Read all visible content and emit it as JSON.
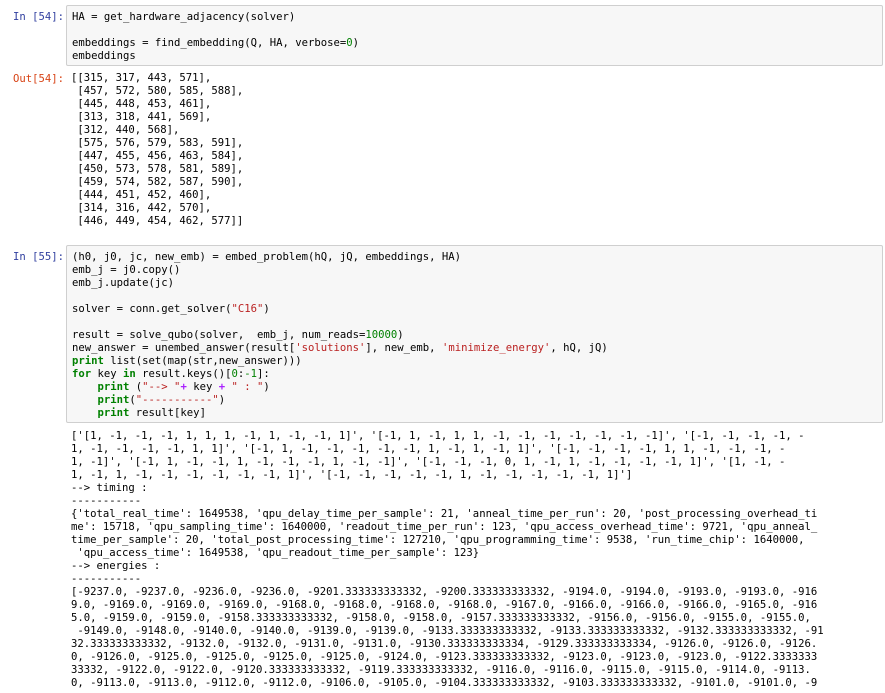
{
  "cells": [
    {
      "in_prompt": "In [54]:",
      "code": {
        "line1": "HA = get_hardware_adjacency(solver)",
        "line2_a": "embeddings = find_embedding(Q, HA, verbose=",
        "line2_num": "0",
        "line2_b": ")",
        "line3": "embeddings"
      },
      "out_prompt": "Out[54]:",
      "output_lines": [
        "[[315, 317, 443, 571],",
        " [457, 572, 580, 585, 588],",
        " [445, 448, 453, 461],",
        " [313, 318, 441, 569],",
        " [312, 440, 568],",
        " [575, 576, 579, 583, 591],",
        " [447, 455, 456, 463, 584],",
        " [450, 573, 578, 581, 589],",
        " [459, 574, 582, 587, 590],",
        " [444, 451, 452, 460],",
        " [314, 316, 442, 570],",
        " [446, 449, 454, 462, 577]]"
      ]
    },
    {
      "in_prompt": "In [55]:",
      "code": {
        "l1": "(h0, j0, jc, new_emb) = embed_problem(hQ, jQ, embeddings, HA)",
        "l2": "emb_j = j0.copy()",
        "l3": "emb_j.update(jc)",
        "l4_a": "solver = conn.get_solver(",
        "l4_str": "\"C16\"",
        "l4_b": ")",
        "l5_a": "result = solve_qubo(solver,  emb_j, num_reads=",
        "l5_num": "10000",
        "l5_b": ")",
        "l6_a": "new_answer = unembed_answer(result[",
        "l6_str1": "'solutions'",
        "l6_b": "], new_emb, ",
        "l6_str2": "'minimize_energy'",
        "l6_c": ", hQ, jQ)",
        "l7_kw": "print",
        "l7_rest": " list(set(map(str,new_answer)))",
        "l8_kw1": "for",
        "l8_a": " key ",
        "l8_kw2": "in",
        "l8_b": " result.keys()[",
        "l8_n1": "0",
        "l8_c": ":",
        "l8_n2": "-1",
        "l8_d": "]:",
        "l9_kw": "print",
        "l9_a": " (",
        "l9_str1": "\"--> \"",
        "l9_op1": "+",
        "l9_b": " key ",
        "l9_op2": "+",
        "l9_str2": "\" : \"",
        "l9_c": ")",
        "l10_kw": "print",
        "l10_a": "(",
        "l10_str": "\"-----------\"",
        "l10_b": ")",
        "l11_kw": "print",
        "l11_a": " result[key]"
      },
      "stdout_lines": [
        "['[1, -1, -1, -1, 1, 1, 1, -1, 1, -1, -1, 1]', '[-1, 1, -1, 1, 1, -1, -1, -1, -1, -1, -1, -1]', '[-1, -1, -1, -1, -",
        "1, -1, -1, -1, -1, 1, 1]', '[-1, 1, -1, -1, -1, -1, -1, 1, -1, 1, -1, 1]', '[-1, -1, -1, -1, 1, 1, -1, -1, -1, -",
        "1, -1]', '[-1, 1, -1, -1, 1, -1, -1, -1, 1, -1, -1]', '[-1, -1, -1, 0, 1, -1, 1, -1, -1, -1, -1, 1]', '[1, -1, -",
        "1, -1, 1, -1, -1, -1, -1, -1, -1, 1]', '[-1, -1, -1, -1, -1, 1, -1, -1, -1, -1, -1, 1]']",
        "--> timing :",
        "-----------",
        "{'total_real_time': 1649538, 'qpu_delay_time_per_sample': 21, 'anneal_time_per_run': 20, 'post_processing_overhead_ti",
        "me': 15718, 'qpu_sampling_time': 1640000, 'readout_time_per_run': 123, 'qpu_access_overhead_time': 9721, 'qpu_anneal_",
        "time_per_sample': 20, 'total_post_processing_time': 127210, 'qpu_programming_time': 9538, 'run_time_chip': 1640000,",
        " 'qpu_access_time': 1649538, 'qpu_readout_time_per_sample': 123}",
        "--> energies :",
        "-----------",
        "[-9237.0, -9237.0, -9236.0, -9236.0, -9201.333333333332, -9200.333333333332, -9194.0, -9194.0, -9193.0, -9193.0, -916",
        "9.0, -9169.0, -9169.0, -9169.0, -9168.0, -9168.0, -9168.0, -9168.0, -9167.0, -9166.0, -9166.0, -9166.0, -9165.0, -916",
        "5.0, -9159.0, -9159.0, -9158.333333333332, -9158.0, -9158.0, -9157.333333333332, -9156.0, -9156.0, -9155.0, -9155.0,",
        " -9149.0, -9148.0, -9140.0, -9140.0, -9139.0, -9139.0, -9133.333333333332, -9133.333333333332, -9132.333333333332, -91",
        "32.333333333332, -9132.0, -9132.0, -9131.0, -9131.0, -9130.333333333334, -9129.333333333334, -9126.0, -9126.0, -9126.",
        "0, -9126.0, -9125.0, -9125.0, -9125.0, -9125.0, -9124.0, -9123.333333333332, -9123.0, -9123.0, -9123.0, -9122.3333333",
        "33332, -9122.0, -9122.0, -9120.333333333332, -9119.333333333332, -9116.0, -9116.0, -9115.0, -9115.0, -9114.0, -9113.",
        "0, -9113.0, -9113.0, -9112.0, -9112.0, -9106.0, -9105.0, -9104.333333333332, -9103.333333333332, -9101.0, -9101.0, -9"
      ]
    }
  ]
}
